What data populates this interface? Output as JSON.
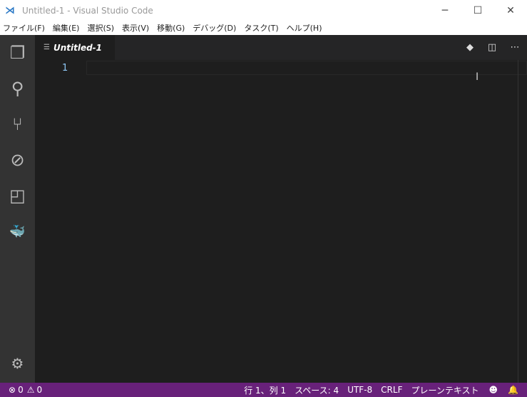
{
  "window": {
    "title": "Untitled-1 - Visual Studio Code"
  },
  "menu": [
    "ファイル(F)",
    "編集(E)",
    "選択(S)",
    "表示(V)",
    "移動(G)",
    "デバッグ(D)",
    "タスク(T)",
    "ヘルプ(H)"
  ],
  "tab": {
    "label": "Untitled-1"
  },
  "editor": {
    "line_numbers": [
      "1"
    ]
  },
  "status": {
    "errors": "0",
    "warnings": "0",
    "position": "行 1、列 1",
    "indent": "スペース: 4",
    "encoding": "UTF-8",
    "eol": "CRLF",
    "language": "プレーンテキスト"
  },
  "colors": {
    "status_bg": "#68217a",
    "activity_bg": "#333333",
    "editor_bg": "#1e1e1e"
  }
}
